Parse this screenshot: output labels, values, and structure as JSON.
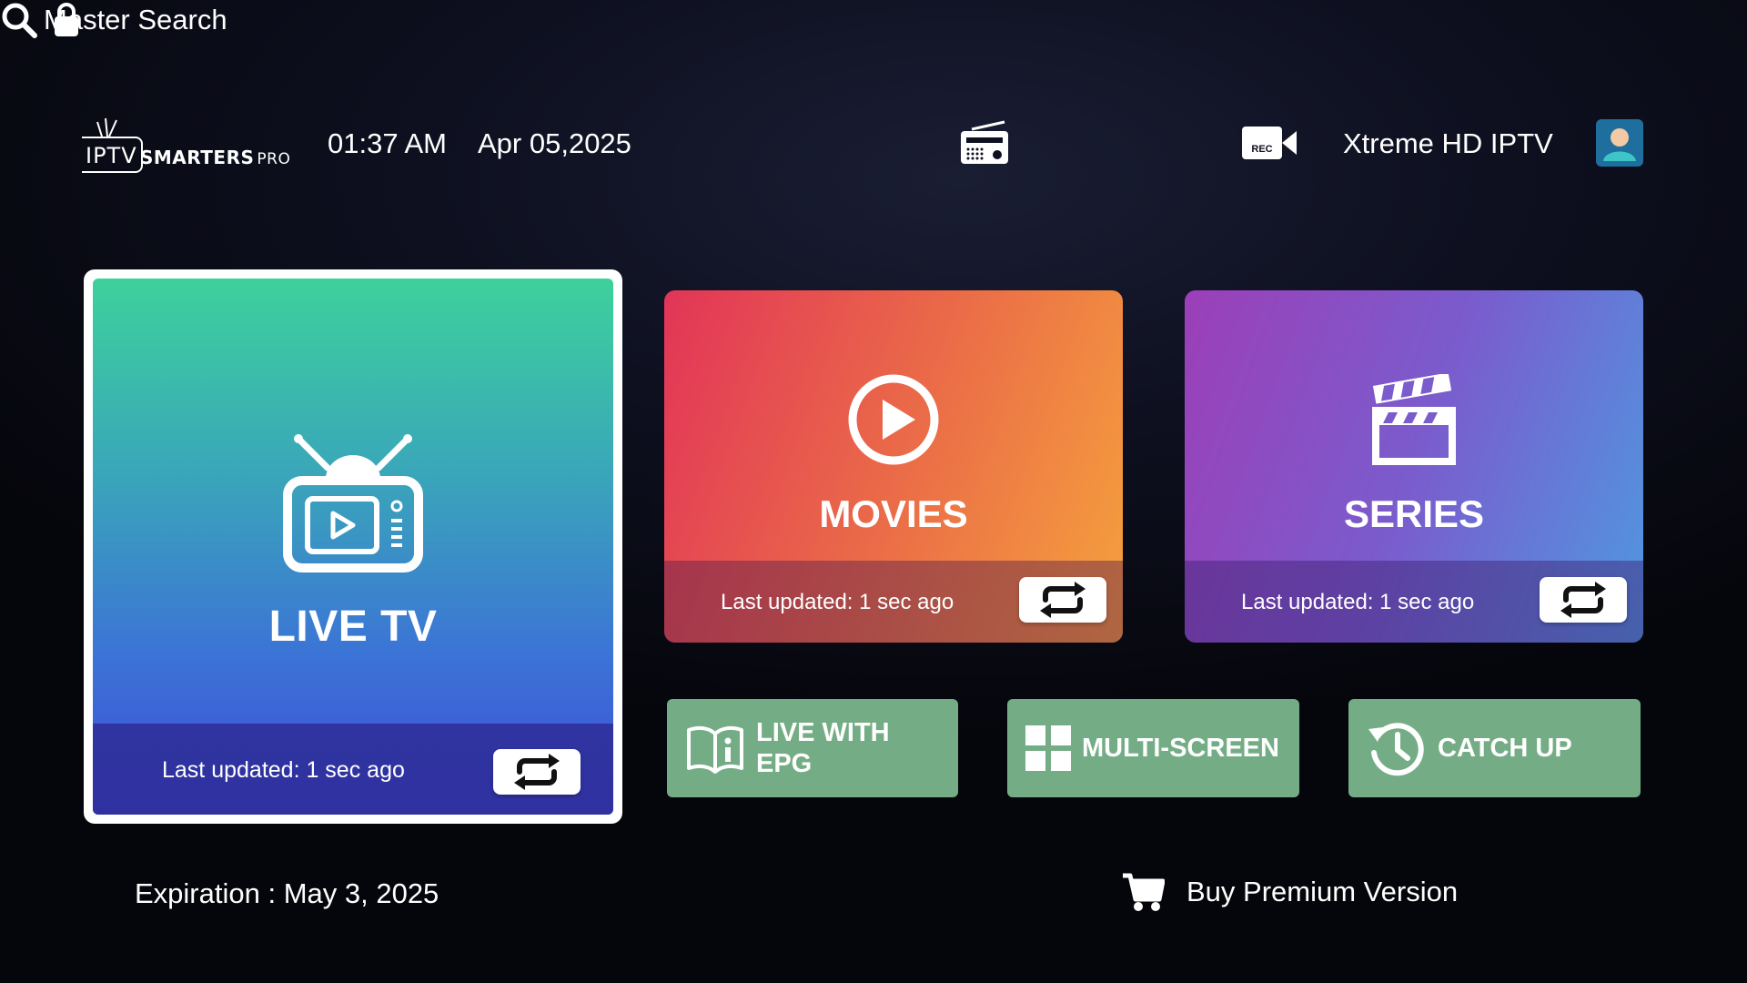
{
  "app": {
    "logo_primary": "IPTV",
    "logo_secondary": "SMARTERS",
    "logo_suffix": "PRO"
  },
  "header": {
    "time": "01:37 AM",
    "date": "Apr 05,2025",
    "search_label": "Master Search",
    "provider_name": "Xtreme HD IPTV",
    "icons": [
      "search-icon",
      "lock-icon",
      "radio-icon",
      "record-camera-icon",
      "avatar-icon"
    ]
  },
  "tiles": {
    "live_tv": {
      "title": "LIVE TV",
      "updated": "Last updated: 1 sec ago",
      "selected": true
    },
    "movies": {
      "title": "MOVIES",
      "updated": "Last updated: 1 sec ago"
    },
    "series": {
      "title": "SERIES",
      "updated": "Last updated: 1 sec ago"
    }
  },
  "actions": {
    "live_epg": "LIVE WITH\nEPG",
    "multi_screen": "MULTI-SCREEN",
    "catch_up": "CATCH UP"
  },
  "footer": {
    "expiration": "Expiration : May 3, 2025",
    "buy_premium": "Buy Premium Version"
  },
  "colors": {
    "live_tv_top": "#3dd19c",
    "live_tv_bottom": "#3f4bd8",
    "movies_start": "#e23558",
    "movies_end": "#f5a13d",
    "series_start": "#9c3fb8",
    "series_end": "#4f98e0",
    "action_green": "#74ad85",
    "background": "#07080e"
  }
}
